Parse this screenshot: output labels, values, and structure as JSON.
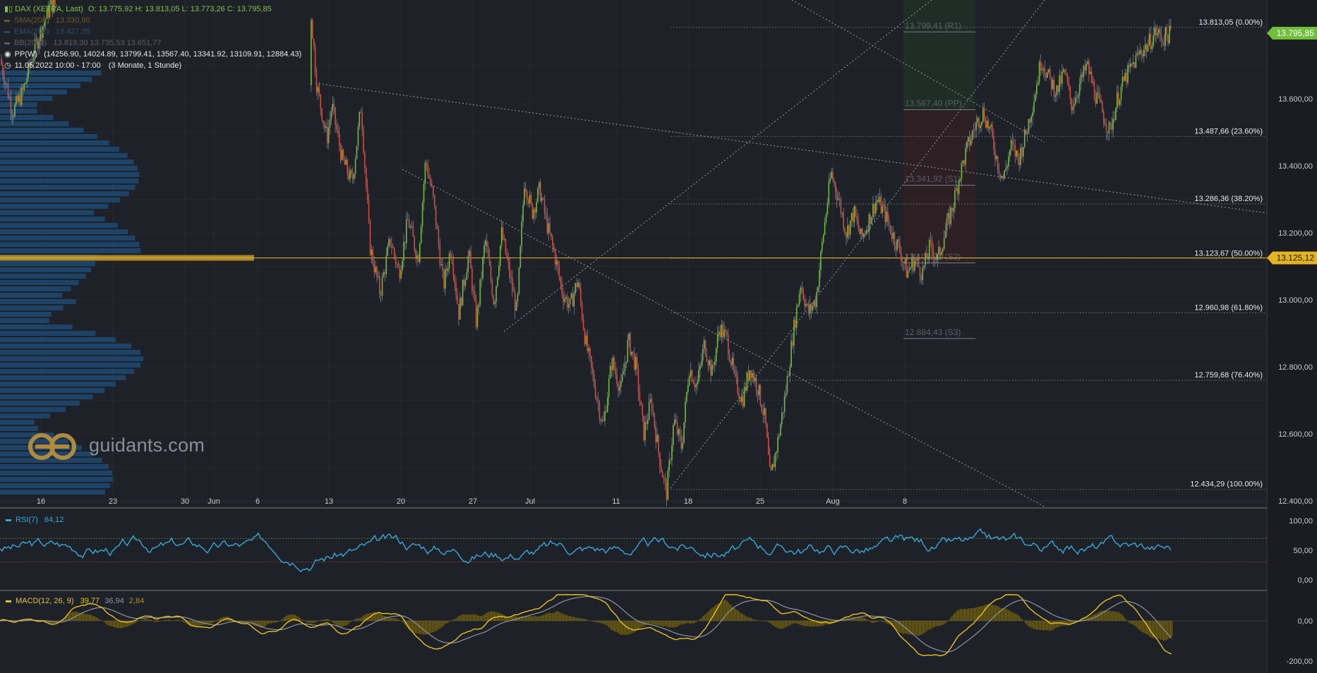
{
  "legend": {
    "title": "DAX (XETRA, Last)",
    "ohlc": "O: 13.775,92  H: 13.813,05  L: 13.773,26  C: 13.795,85",
    "sma_label": "SMA(200)",
    "sma_value": "13.330,90",
    "ema_label": "EMA(200)",
    "ema_value": "13.427,35",
    "bb_label": "BB(20, 2)",
    "bb_value": "13.819,30  13.735,53  13.651,77",
    "pp_label": "PP(W)",
    "pp_value": "(14256.90, 14024.89, 13799.41, 13567.40, 13341.92, 13109.91, 12884.43)",
    "date_label": "11.05.2022 10:00 - 17:00",
    "range_label": "(3 Monate, 1 Stunde)"
  },
  "logo_text": "guidants.com",
  "colors": {
    "up": "#6fbf3b",
    "down": "#e0463a",
    "wick": "#9aa0a6",
    "price_badge": "#6fbf3b",
    "level_badge": "#e6b422",
    "rsi": "#37a8d6",
    "macd": "#e6c21f",
    "volume_profile": "#1f4f7e"
  },
  "chart_data": [
    {
      "type": "candlestick",
      "x_ticks": [
        "16",
        "23",
        "30",
        "Jun",
        "6",
        "13",
        "20",
        "27",
        "Jul",
        "11",
        "18",
        "25",
        "Aug",
        "8"
      ],
      "y_ticks": [
        "12.400,00",
        "12.600,00",
        "12.800,00",
        "13.000,00",
        "13.200,00",
        "13.400,00",
        "13.600,00"
      ],
      "ylim": [
        12390,
        13880
      ],
      "current_price": "13.795,85",
      "highlight_level": "13.125,12",
      "fib_levels": [
        {
          "label": "13.813,05 (0.00%)",
          "value": 13813.05
        },
        {
          "label": "13.487,66 (23.60%)",
          "value": 13487.66
        },
        {
          "label": "13.286,36 (38.20%)",
          "value": 13286.36
        },
        {
          "label": "13.123,67 (50.00%)",
          "value": 13123.67
        },
        {
          "label": "12.960,98 (61.80%)",
          "value": 12960.98
        },
        {
          "label": "12.759,68 (76.40%)",
          "value": 12759.68
        },
        {
          "label": "12.434,29 (100.00%)",
          "value": 12434.29
        }
      ],
      "pivot_levels": [
        {
          "label": "13.799,41 (R1)",
          "value": 13799.41
        },
        {
          "label": "13.567,40 (PP)",
          "value": 13567.4
        },
        {
          "label": "13.341,92 (S1)",
          "value": 13341.92
        },
        {
          "label": "13.109,91 (S2)",
          "value": 13109.91
        },
        {
          "label": "12.884,43 (S3)",
          "value": 12884.43
        }
      ],
      "path": [
        [
          0.0,
          13720
        ],
        [
          0.01,
          13560
        ],
        [
          0.018,
          13620
        ],
        [
          0.025,
          13720
        ],
        [
          0.03,
          13780
        ],
        [
          0.04,
          13880
        ],
        [
          0.245,
          13880
        ],
        [
          0.25,
          13640
        ],
        [
          0.258,
          13480
        ],
        [
          0.262,
          13580
        ],
        [
          0.27,
          13420
        ],
        [
          0.278,
          13350
        ],
        [
          0.285,
          13580
        ],
        [
          0.292,
          13160
        ],
        [
          0.3,
          13020
        ],
        [
          0.308,
          13180
        ],
        [
          0.315,
          13080
        ],
        [
          0.322,
          13240
        ],
        [
          0.33,
          13120
        ],
        [
          0.336,
          13420
        ],
        [
          0.342,
          13300
        ],
        [
          0.35,
          13040
        ],
        [
          0.356,
          13160
        ],
        [
          0.362,
          12960
        ],
        [
          0.37,
          13140
        ],
        [
          0.376,
          12930
        ],
        [
          0.383,
          13180
        ],
        [
          0.39,
          12990
        ],
        [
          0.396,
          13200
        ],
        [
          0.402,
          13080
        ],
        [
          0.408,
          12960
        ],
        [
          0.414,
          13360
        ],
        [
          0.42,
          13260
        ],
        [
          0.426,
          13330
        ],
        [
          0.432,
          13220
        ],
        [
          0.438,
          13130
        ],
        [
          0.444,
          13020
        ],
        [
          0.45,
          12980
        ],
        [
          0.456,
          13060
        ],
        [
          0.462,
          12880
        ],
        [
          0.47,
          12730
        ],
        [
          0.476,
          12620
        ],
        [
          0.483,
          12820
        ],
        [
          0.49,
          12730
        ],
        [
          0.496,
          12880
        ],
        [
          0.502,
          12800
        ],
        [
          0.508,
          12600
        ],
        [
          0.514,
          12700
        ],
        [
          0.52,
          12540
        ],
        [
          0.526,
          12420
        ],
        [
          0.532,
          12640
        ],
        [
          0.538,
          12560
        ],
        [
          0.544,
          12800
        ],
        [
          0.55,
          12740
        ],
        [
          0.556,
          12870
        ],
        [
          0.562,
          12780
        ],
        [
          0.568,
          12920
        ],
        [
          0.574,
          12880
        ],
        [
          0.58,
          12760
        ],
        [
          0.586,
          12700
        ],
        [
          0.592,
          12800
        ],
        [
          0.598,
          12740
        ],
        [
          0.604,
          12640
        ],
        [
          0.608,
          12460
        ],
        [
          0.614,
          12580
        ],
        [
          0.62,
          12720
        ],
        [
          0.626,
          12900
        ],
        [
          0.632,
          13050
        ],
        [
          0.638,
          12960
        ],
        [
          0.644,
          13000
        ],
        [
          0.65,
          13200
        ],
        [
          0.656,
          13380
        ],
        [
          0.662,
          13300
        ],
        [
          0.668,
          13200
        ],
        [
          0.674,
          13260
        ],
        [
          0.68,
          13180
        ],
        [
          0.686,
          13240
        ],
        [
          0.692,
          13300
        ],
        [
          0.698,
          13260
        ],
        [
          0.704,
          13200
        ],
        [
          0.71,
          13150
        ],
        [
          0.716,
          13080
        ],
        [
          0.722,
          13120
        ],
        [
          0.728,
          13080
        ],
        [
          0.734,
          13160
        ],
        [
          0.74,
          13120
        ],
        [
          0.746,
          13200
        ],
        [
          0.752,
          13280
        ],
        [
          0.758,
          13380
        ],
        [
          0.764,
          13460
        ],
        [
          0.77,
          13520
        ],
        [
          0.776,
          13560
        ],
        [
          0.782,
          13500
        ],
        [
          0.788,
          13400
        ],
        [
          0.792,
          13360
        ],
        [
          0.798,
          13460
        ],
        [
          0.804,
          13420
        ],
        [
          0.81,
          13500
        ],
        [
          0.816,
          13600
        ],
        [
          0.822,
          13720
        ],
        [
          0.828,
          13660
        ],
        [
          0.834,
          13620
        ],
        [
          0.84,
          13680
        ],
        [
          0.846,
          13580
        ],
        [
          0.852,
          13640
        ],
        [
          0.858,
          13700
        ],
        [
          0.864,
          13620
        ],
        [
          0.87,
          13560
        ],
        [
          0.876,
          13500
        ],
        [
          0.882,
          13600
        ],
        [
          0.888,
          13660
        ],
        [
          0.894,
          13700
        ],
        [
          0.9,
          13740
        ],
        [
          0.906,
          13760
        ],
        [
          0.912,
          13800
        ],
        [
          0.918,
          13780
        ],
        [
          0.924,
          13796
        ]
      ],
      "plot_x_range": [
        0,
        1
      ]
    },
    {
      "type": "line",
      "title": "RSI(7)",
      "value_label": "64,12",
      "y_ticks": [
        "100,00",
        "50,00",
        "0,00"
      ],
      "ylim": [
        0,
        100
      ],
      "upper_band": 70,
      "lower_band": 30
    },
    {
      "type": "line",
      "title": "MACD(12, 26, 9)",
      "macd_value": "39,77",
      "signal_value": "36,94",
      "hist_value": "2,84",
      "y_ticks": [
        "0,00",
        "-200,00"
      ],
      "ylim": [
        -270,
        150
      ]
    }
  ]
}
